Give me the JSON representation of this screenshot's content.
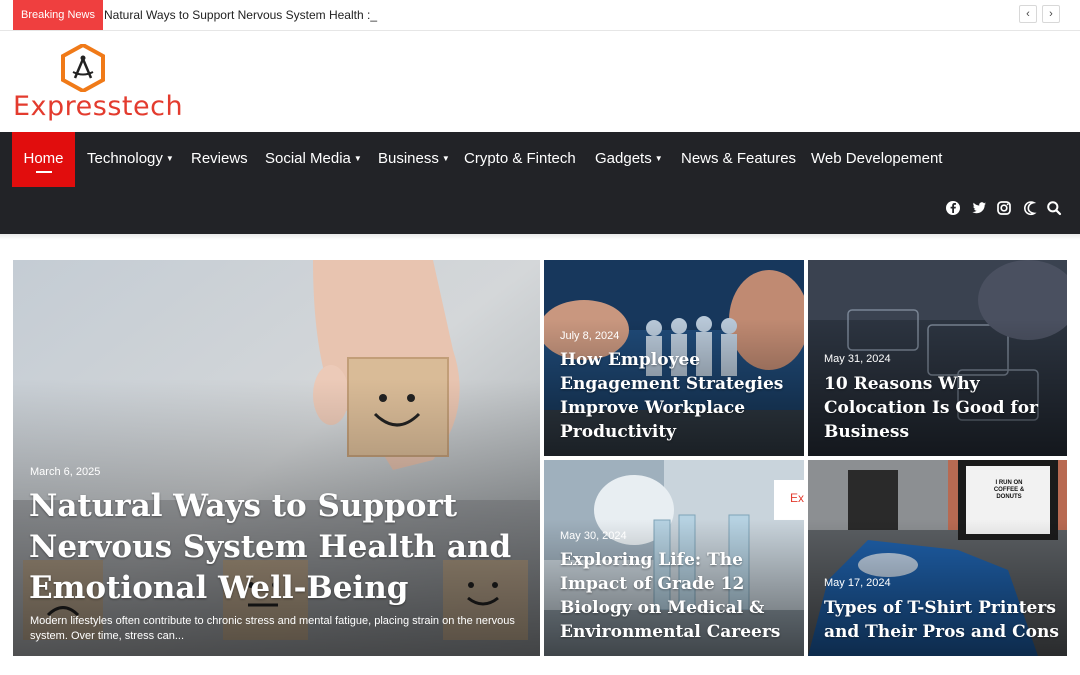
{
  "breaking": {
    "label": "Breaking News",
    "text": "Natural Ways to Support Nervous System Health :_"
  },
  "site": {
    "name": "Expresstech"
  },
  "nav": {
    "items": [
      {
        "label": "Home"
      },
      {
        "label": "Technology"
      },
      {
        "label": "Reviews"
      },
      {
        "label": "Social Media"
      },
      {
        "label": "Business"
      },
      {
        "label": "Crypto & Fintech"
      },
      {
        "label": "Gadgets"
      },
      {
        "label": "News & Features"
      },
      {
        "label": "Web Developement"
      }
    ]
  },
  "featured": {
    "main": {
      "date": "March 6, 2025",
      "title": "Natural Ways to Support Nervous System Health and Emotional Well-Being",
      "excerpt": "Modern lifestyles often contribute to chronic stress and mental fatigue, placing strain on the nervous system. Over time, stress can..."
    },
    "cards": [
      {
        "date": "July 8, 2024",
        "title": "How Employee Engagement Strategies Improve Workplace Productivity"
      },
      {
        "date": "May 31, 2024",
        "title": "10 Reasons Why Colocation Is Good for Business"
      },
      {
        "date": "May 30, 2024",
        "title": "Exploring Life: The Impact of Grade 12 Biology on Medical & Environmental Careers"
      },
      {
        "date": "May 17, 2024",
        "title": "Types of T-Shirt Printers and Their Pros and Cons"
      }
    ],
    "mug_text": "I RUN ON COFFEE & DONUTS",
    "lab_tag": "Ex"
  },
  "colors": {
    "accent": "#e10d0d",
    "nav_bg": "#222327",
    "breaking_bg": "#ef3f3f"
  }
}
